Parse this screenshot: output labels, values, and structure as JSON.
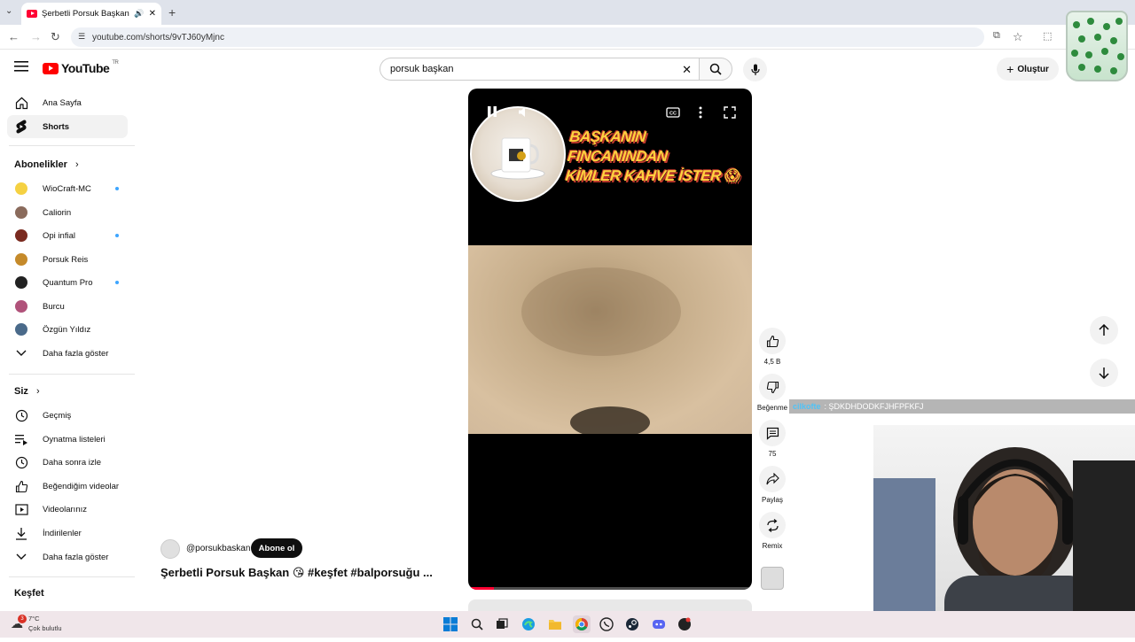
{
  "browser": {
    "tab_title": "Şerbetli Porsuk Başkan 😘#",
    "url": "youtube.com/shorts/9vTJ60yMjnc"
  },
  "header": {
    "logo_text": "YouTube",
    "region": "TR",
    "search_value": "porsuk başkan",
    "create_label": "Oluştur"
  },
  "sidebar": {
    "main": [
      {
        "label": "Ana Sayfa"
      },
      {
        "label": "Shorts"
      }
    ],
    "subscriptions_heading": "Abonelikler",
    "subscriptions": [
      {
        "label": "WioCraft-MC",
        "color": "#f5d142",
        "new": true
      },
      {
        "label": "Caliorin",
        "color": "#8a6b5c",
        "new": false
      },
      {
        "label": "Opi infial",
        "color": "#7a2a1f",
        "new": true
      },
      {
        "label": "Porsuk Reis",
        "color": "#c58a2a",
        "new": false
      },
      {
        "label": "Quantum Pro",
        "color": "#222222",
        "new": true
      },
      {
        "label": "Burcu",
        "color": "#b0527a",
        "new": false
      },
      {
        "label": "Özgün Yıldız",
        "color": "#4a6a8a",
        "new": false
      }
    ],
    "show_more_1": "Daha fazla göster",
    "you_heading": "Siz",
    "you_items": [
      {
        "label": "Geçmiş"
      },
      {
        "label": "Oynatma listeleri"
      },
      {
        "label": "Daha sonra izle"
      },
      {
        "label": "Beğendiğim videolar"
      },
      {
        "label": "Videolarınız"
      },
      {
        "label": "İndirilenler"
      }
    ],
    "show_more_2": "Daha fazla göster",
    "explore_heading": "Keşfet"
  },
  "video": {
    "overlay_title_line1": "BAŞKANIN FINCANINDAN",
    "overlay_title_line2": "KİMLER KAHVE İSTER 😱",
    "progress": 0.09,
    "channel": "@porsukbaskan",
    "subscribe_label": "Abone ol",
    "title": "Şerbetli Porsuk Başkan 😘 #keşfet #balporsuğu ..."
  },
  "actions": {
    "likes": "4,5 B",
    "dislike_label": "Beğenme",
    "comments": "75",
    "share_label": "Paylaş",
    "remix_label": "Remix"
  },
  "chat": {
    "user": "cilkofte",
    "message": ": ŞDKDHDODKFJHFPFKFJ"
  },
  "taskbar": {
    "temperature": "7°C",
    "weather": "Çok bulutlu",
    "notification_count": "3"
  }
}
